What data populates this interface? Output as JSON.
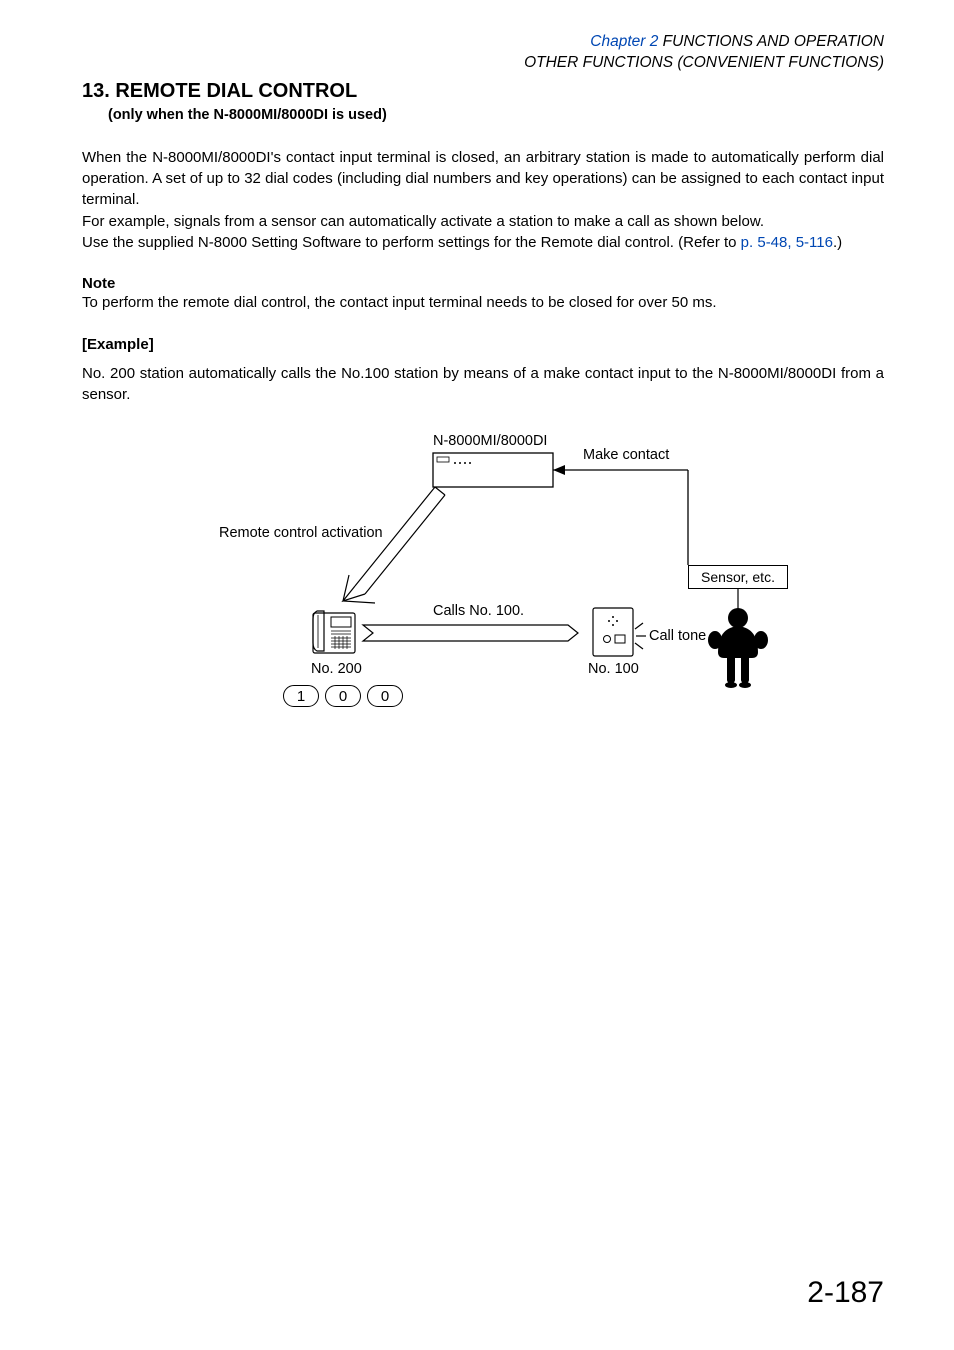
{
  "header": {
    "chapter_prefix": "Chapter 2",
    "chapter_title": "   FUNCTIONS AND OPERATION",
    "subtitle": "OTHER FUNCTIONS (CONVENIENT FUNCTIONS)"
  },
  "section": {
    "title": "13. REMOTE DIAL CONTROL",
    "subtitle": "(only when the N-8000MI/8000DI is used)"
  },
  "body": {
    "p1": "When the N-8000MI/8000DI's contact input terminal is closed, an arbitrary station is made to automatically perform dial operation. A set of up to 32 dial codes (including dial numbers and key operations) can be assigned to each contact input terminal.",
    "p2": "For example, signals from a sensor can automatically activate a station to make a call as shown below.",
    "p3a": "Use the supplied N-8000 Setting Software to perform settings for the Remote dial control. (Refer to ",
    "link1": "p. 5-48",
    "comma": ", ",
    "link2": "5-116",
    "p3b": ".)"
  },
  "note": {
    "heading": "Note",
    "text": "To perform the remote dial control, the contact input terminal needs to be closed for over 50 ms."
  },
  "example": {
    "heading": "[Example]",
    "text": "No. 200 station automatically calls the No.100 station by means of a make contact input to the N-8000MI/8000DI from a sensor."
  },
  "diagram": {
    "device_label": "N-8000MI/8000DI",
    "make_contact": "Make contact",
    "remote_activation": "Remote control activation",
    "calls_text": "Calls No. 100.",
    "call_tone": "Call tone",
    "sensor_box": "Sensor, etc.",
    "station_left": "No. 200",
    "station_right": "No. 100",
    "dial": [
      "1",
      "0",
      "0"
    ]
  },
  "page_number": "2-187"
}
